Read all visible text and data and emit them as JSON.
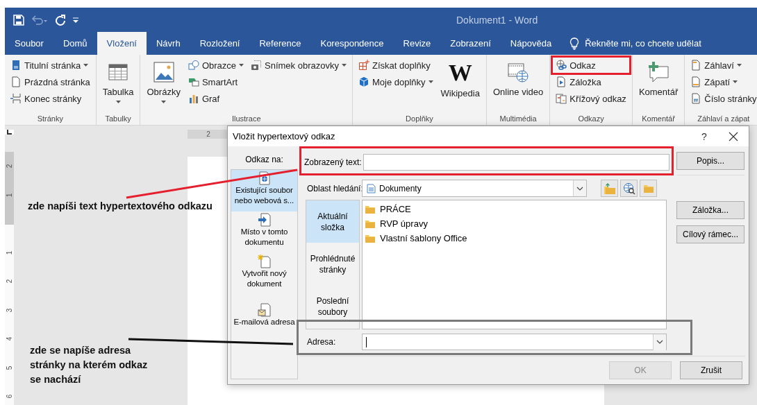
{
  "title_bar": {
    "title": "Dokument1 - Word"
  },
  "tabs": [
    {
      "label": "Soubor",
      "selected": false
    },
    {
      "label": "Domů",
      "selected": false
    },
    {
      "label": "Vložení",
      "selected": true
    },
    {
      "label": "Návrh",
      "selected": false
    },
    {
      "label": "Rozložení",
      "selected": false
    },
    {
      "label": "Reference",
      "selected": false
    },
    {
      "label": "Korespondence",
      "selected": false
    },
    {
      "label": "Revize",
      "selected": false
    },
    {
      "label": "Zobrazení",
      "selected": false
    },
    {
      "label": "Nápověda",
      "selected": false
    }
  ],
  "tell_me": {
    "placeholder": "Řekněte mi, co chcete udělat"
  },
  "ribbon": {
    "groups": [
      {
        "label": "Stránky",
        "columns": [
          [
            {
              "label": "Titulní stránka",
              "kind": "small",
              "dropdown": true,
              "framed": false
            },
            {
              "label": "Prázdná stránka",
              "kind": "small",
              "dropdown": false,
              "framed": false
            },
            {
              "label": "Konec stránky",
              "kind": "small",
              "dropdown": false,
              "framed": false
            }
          ]
        ]
      },
      {
        "label": "Tabulky",
        "columns": [
          [
            {
              "label": "Tabulka",
              "kind": "large",
              "dropdown": true,
              "framed": false
            }
          ]
        ]
      },
      {
        "label": "Ilustrace",
        "columns": [
          [
            {
              "label": "Obrázky",
              "kind": "large",
              "dropdown": true,
              "framed": false
            }
          ],
          [
            {
              "label": "Obrazce",
              "kind": "small",
              "dropdown": true,
              "framed": false
            },
            {
              "label": "SmartArt",
              "kind": "small",
              "dropdown": false,
              "framed": false
            },
            {
              "label": "Graf",
              "kind": "small",
              "dropdown": false,
              "framed": false
            }
          ],
          [
            {
              "label": "Snímek obrazovky",
              "kind": "small",
              "dropdown": true,
              "framed": false
            }
          ]
        ]
      },
      {
        "label": "Doplňky",
        "columns": [
          [
            {
              "label": "Získat doplňky",
              "kind": "small",
              "dropdown": false,
              "framed": false
            },
            {
              "label": "Moje doplňky",
              "kind": "small",
              "dropdown": true,
              "framed": false
            }
          ],
          [
            {
              "label": "Wikipedia",
              "kind": "large",
              "glyph": "W",
              "dropdown": false,
              "framed": false
            }
          ]
        ]
      },
      {
        "label": "Multimédia",
        "columns": [
          [
            {
              "label": "Online video",
              "kind": "large",
              "dropdown": false,
              "framed": false
            }
          ]
        ]
      },
      {
        "label": "Odkazy",
        "columns": [
          [
            {
              "label": "Odkaz",
              "kind": "small",
              "dropdown": false,
              "framed": true
            },
            {
              "label": "Záložka",
              "kind": "small",
              "dropdown": false,
              "framed": false
            },
            {
              "label": "Křížový odkaz",
              "kind": "small",
              "dropdown": false,
              "framed": false
            }
          ]
        ]
      },
      {
        "label": "Komentář",
        "columns": [
          [
            {
              "label": "Komentář",
              "kind": "large",
              "dropdown": false,
              "framed": false
            }
          ]
        ]
      },
      {
        "label": "Záhlaví a zápat",
        "columns": [
          [
            {
              "label": "Záhlaví",
              "kind": "small",
              "dropdown": true,
              "framed": false
            },
            {
              "label": "Zápatí",
              "kind": "small",
              "dropdown": true,
              "framed": false
            },
            {
              "label": "Číslo stránky",
              "kind": "small",
              "dropdown": false,
              "framed": false
            }
          ]
        ]
      }
    ]
  },
  "rulers": {
    "horizontal_marks": [
      "2"
    ],
    "vertical_marks": [
      "2",
      "1",
      "1",
      "2",
      "3",
      "4",
      "5",
      "6"
    ]
  },
  "dialog": {
    "title": "Vložit hypertextový odkaz",
    "help": "?",
    "link_to": {
      "label": "Odkaz na:",
      "items": [
        {
          "label": "Existující soubor nebo webová s...",
          "selected": true
        },
        {
          "label": "Místo v tomto dokumentu",
          "selected": false
        },
        {
          "label": "Vytvořit nový dokument",
          "selected": false
        },
        {
          "label": "E-mailová adresa",
          "selected": false
        }
      ]
    },
    "display_text": {
      "label": "Zobrazený text:",
      "framed": true
    },
    "look_in": {
      "label": "Oblast hledání:",
      "value": "Dokumenty"
    },
    "views": [
      {
        "label": "Aktuální složka",
        "selected": true
      },
      {
        "label": "Prohlédnuté stránky",
        "selected": false
      },
      {
        "label": "Poslední soubory",
        "selected": false
      }
    ],
    "files": [
      "PRÁCE",
      "RVP úpravy",
      "Vlastní šablony Office"
    ],
    "address": {
      "label": "Adresa:",
      "framed": true
    },
    "side_buttons": [
      "Popis...",
      "Záložka...",
      "Cílový rámec..."
    ],
    "buttons": [
      {
        "label": "OK",
        "disabled": true
      },
      {
        "label": "Zrušit",
        "disabled": false
      }
    ]
  },
  "notes": [
    {
      "text": "zde napíši text hypertextového odkazu",
      "kind": "red"
    },
    {
      "text": "zde se napíše adresa stránky na kterém odkaz se nachází",
      "kind": "black"
    }
  ]
}
